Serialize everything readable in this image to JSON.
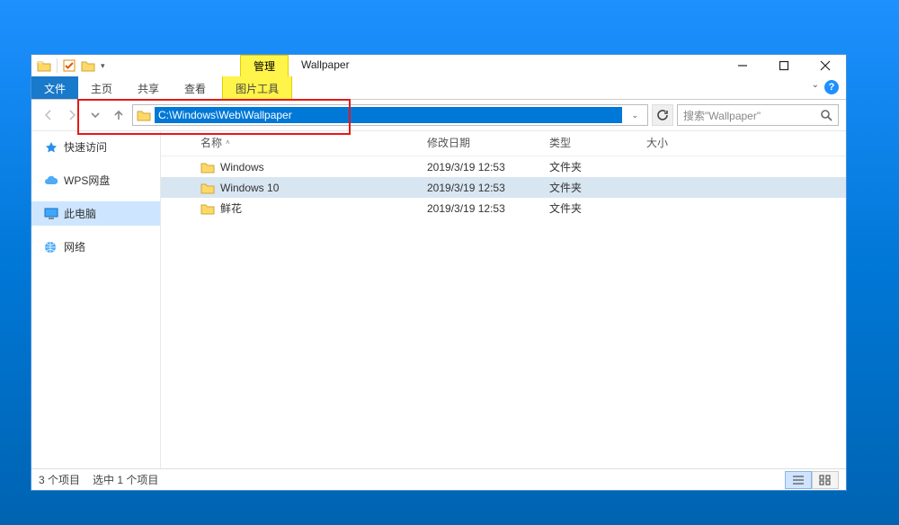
{
  "title": "Wallpaper",
  "ribbon_context_tab": "管理",
  "ribbon": {
    "file": "文件",
    "tabs": [
      "主页",
      "共享",
      "查看"
    ],
    "image_tools": "图片工具"
  },
  "address": {
    "path": "C:\\Windows\\Web\\Wallpaper"
  },
  "search": {
    "placeholder": "搜索\"Wallpaper\""
  },
  "sidebar": {
    "items": [
      {
        "label": "快速访问",
        "icon": "star"
      },
      {
        "label": "WPS网盘",
        "icon": "cloud"
      },
      {
        "label": "此电脑",
        "icon": "monitor",
        "selected": true
      },
      {
        "label": "网络",
        "icon": "globe"
      }
    ]
  },
  "columns": {
    "name": "名称",
    "modified": "修改日期",
    "type": "类型",
    "size": "大小"
  },
  "rows": [
    {
      "name": "Windows",
      "modified": "2019/3/19 12:53",
      "type": "文件夹",
      "size": ""
    },
    {
      "name": "Windows 10",
      "modified": "2019/3/19 12:53",
      "type": "文件夹",
      "size": "",
      "selected": true
    },
    {
      "name": "鲜花",
      "modified": "2019/3/19 12:53",
      "type": "文件夹",
      "size": ""
    }
  ],
  "status": {
    "count": "3 个项目",
    "selection": "选中 1 个项目"
  }
}
